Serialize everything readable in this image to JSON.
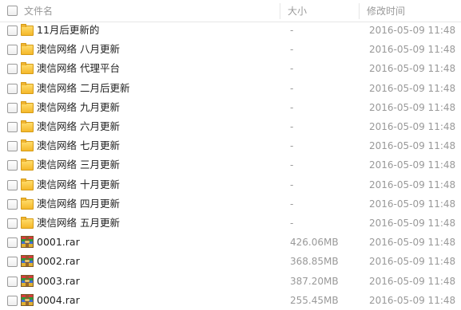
{
  "columns": {
    "name": "文件名",
    "size": "大小",
    "modified": "修改时间"
  },
  "colors": {
    "folder": "#f5b82a",
    "rar_stripes": [
      "#d93a3a",
      "#2a9d3a",
      "#3a6fd9",
      "#e0b030"
    ]
  },
  "rows": [
    {
      "type": "folder",
      "icon": "folder-icon",
      "name": "11月后更新的",
      "size": "-",
      "date": "2016-05-09 11:48"
    },
    {
      "type": "folder",
      "icon": "folder-icon",
      "name": "澳信网络 八月更新",
      "size": "-",
      "date": "2016-05-09 11:48"
    },
    {
      "type": "folder",
      "icon": "folder-icon",
      "name": "澳信网络 代理平台",
      "size": "-",
      "date": "2016-05-09 11:48"
    },
    {
      "type": "folder",
      "icon": "folder-icon",
      "name": "澳信网络 二月后更新",
      "size": "-",
      "date": "2016-05-09 11:48"
    },
    {
      "type": "folder",
      "icon": "folder-icon",
      "name": "澳信网络 九月更新",
      "size": "-",
      "date": "2016-05-09 11:48"
    },
    {
      "type": "folder",
      "icon": "folder-icon",
      "name": "澳信网络 六月更新",
      "size": "-",
      "date": "2016-05-09 11:48"
    },
    {
      "type": "folder",
      "icon": "folder-icon",
      "name": "澳信网络 七月更新",
      "size": "-",
      "date": "2016-05-09 11:48"
    },
    {
      "type": "folder",
      "icon": "folder-icon",
      "name": "澳信网络 三月更新",
      "size": "-",
      "date": "2016-05-09 11:48"
    },
    {
      "type": "folder",
      "icon": "folder-icon",
      "name": "澳信网络 十月更新",
      "size": "-",
      "date": "2016-05-09 11:48"
    },
    {
      "type": "folder",
      "icon": "folder-icon",
      "name": "澳信网络 四月更新",
      "size": "-",
      "date": "2016-05-09 11:48"
    },
    {
      "type": "folder",
      "icon": "folder-icon",
      "name": "澳信网络 五月更新",
      "size": "-",
      "date": "2016-05-09 11:48"
    },
    {
      "type": "rar",
      "icon": "rar-archive-icon",
      "name": "0001.rar",
      "size": "426.06MB",
      "date": "2016-05-09 11:48"
    },
    {
      "type": "rar",
      "icon": "rar-archive-icon",
      "name": "0002.rar",
      "size": "368.85MB",
      "date": "2016-05-09 11:48"
    },
    {
      "type": "rar",
      "icon": "rar-archive-icon",
      "name": "0003.rar",
      "size": "387.20MB",
      "date": "2016-05-09 11:48"
    },
    {
      "type": "rar",
      "icon": "rar-archive-icon",
      "name": "0004.rar",
      "size": "255.45MB",
      "date": "2016-05-09 11:48"
    }
  ]
}
